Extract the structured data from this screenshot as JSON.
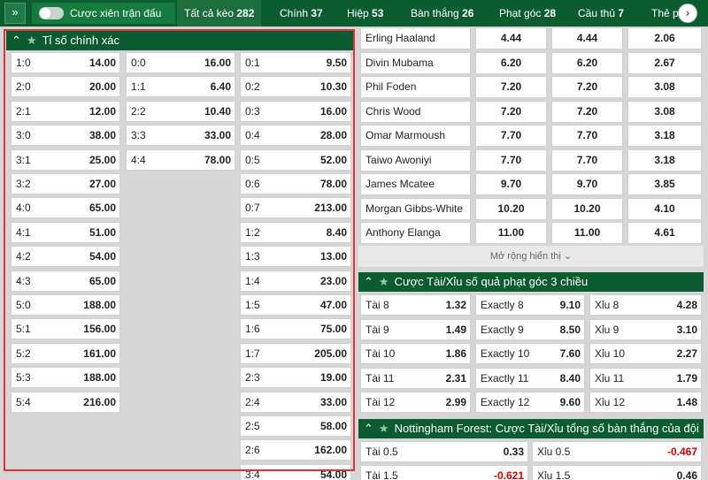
{
  "topbar": {
    "collapse_icon": "chevron-up-double",
    "toggle_label": "Cược xiên trận đấu",
    "tabs": [
      {
        "label": "Tất cả kèo",
        "count": "282",
        "active": true
      },
      {
        "label": "Chính",
        "count": "37"
      },
      {
        "label": "Hiệp",
        "count": "53"
      },
      {
        "label": "Bàn thắng",
        "count": "26"
      },
      {
        "label": "Phạt góc",
        "count": "28"
      },
      {
        "label": "Cầu thủ",
        "count": "7"
      },
      {
        "label": "Thẻ p",
        "count": ""
      }
    ],
    "next_icon": "chevron-right"
  },
  "correct_score": {
    "title": "Tỉ số chính xác",
    "col1": [
      {
        "score": "1:0",
        "odd": "14.00"
      },
      {
        "score": "2:0",
        "odd": "20.00"
      },
      {
        "score": "2:1",
        "odd": "12.00"
      },
      {
        "score": "3:0",
        "odd": "38.00"
      },
      {
        "score": "3:1",
        "odd": "25.00"
      },
      {
        "score": "3:2",
        "odd": "27.00"
      },
      {
        "score": "4:0",
        "odd": "65.00"
      },
      {
        "score": "4:1",
        "odd": "51.00"
      },
      {
        "score": "4:2",
        "odd": "54.00"
      },
      {
        "score": "4:3",
        "odd": "65.00"
      },
      {
        "score": "5:0",
        "odd": "188.00"
      },
      {
        "score": "5:1",
        "odd": "156.00"
      },
      {
        "score": "5:2",
        "odd": "161.00"
      },
      {
        "score": "5:3",
        "odd": "188.00"
      },
      {
        "score": "5:4",
        "odd": "216.00"
      }
    ],
    "col2": [
      {
        "score": "0:0",
        "odd": "16.00"
      },
      {
        "score": "1:1",
        "odd": "6.40"
      },
      {
        "score": "2:2",
        "odd": "10.40"
      },
      {
        "score": "3:3",
        "odd": "33.00"
      },
      {
        "score": "4:4",
        "odd": "78.00"
      }
    ],
    "col3": [
      {
        "score": "0:1",
        "odd": "9.50"
      },
      {
        "score": "0:2",
        "odd": "10.30"
      },
      {
        "score": "0:3",
        "odd": "16.00"
      },
      {
        "score": "0:4",
        "odd": "28.00"
      },
      {
        "score": "0:5",
        "odd": "52.00"
      },
      {
        "score": "0:6",
        "odd": "78.00"
      },
      {
        "score": "0:7",
        "odd": "213.00"
      },
      {
        "score": "1:2",
        "odd": "8.40"
      },
      {
        "score": "1:3",
        "odd": "13.00"
      },
      {
        "score": "1:4",
        "odd": "23.00"
      },
      {
        "score": "1:5",
        "odd": "47.00"
      },
      {
        "score": "1:6",
        "odd": "75.00"
      },
      {
        "score": "1:7",
        "odd": "205.00"
      },
      {
        "score": "2:3",
        "odd": "19.00"
      },
      {
        "score": "2:4",
        "odd": "33.00"
      },
      {
        "score": "2:5",
        "odd": "58.00"
      },
      {
        "score": "2:6",
        "odd": "162.00"
      },
      {
        "score": "3:4",
        "odd": "54.00"
      }
    ]
  },
  "scorers": {
    "rows": [
      {
        "name": "Erling Haaland",
        "o1": "4.44",
        "o2": "4.44",
        "o3": "2.06"
      },
      {
        "name": "Divin Mubama",
        "o1": "6.20",
        "o2": "6.20",
        "o3": "2.67"
      },
      {
        "name": "Phil Foden",
        "o1": "7.20",
        "o2": "7.20",
        "o3": "3.08"
      },
      {
        "name": "Chris Wood",
        "o1": "7.20",
        "o2": "7.20",
        "o3": "3.08"
      },
      {
        "name": "Omar Marmoush",
        "o1": "7.70",
        "o2": "7.70",
        "o3": "3.18"
      },
      {
        "name": "Taiwo Awoniyi",
        "o1": "7.70",
        "o2": "7.70",
        "o3": "3.18"
      },
      {
        "name": "James Mcatee",
        "o1": "9.70",
        "o2": "9.70",
        "o3": "3.85"
      },
      {
        "name": "Morgan Gibbs-White",
        "o1": "10.20",
        "o2": "10.20",
        "o3": "4.10"
      },
      {
        "name": "Anthony Elanga",
        "o1": "11.00",
        "o2": "11.00",
        "o3": "4.61"
      }
    ],
    "expand_label": "Mở rộng hiển thị"
  },
  "corners": {
    "title": "Cược Tài/Xỉu số quả phạt góc 3 chiều",
    "rows": [
      [
        {
          "l": "Tài 8",
          "o": "1.32"
        },
        {
          "l": "Exactly 8",
          "o": "9.10"
        },
        {
          "l": "Xỉu 8",
          "o": "4.28"
        }
      ],
      [
        {
          "l": "Tài 9",
          "o": "1.49"
        },
        {
          "l": "Exactly 9",
          "o": "8.50"
        },
        {
          "l": "Xỉu 9",
          "o": "3.10"
        }
      ],
      [
        {
          "l": "Tài 10",
          "o": "1.86"
        },
        {
          "l": "Exactly 10",
          "o": "7.60"
        },
        {
          "l": "Xỉu 10",
          "o": "2.27"
        }
      ],
      [
        {
          "l": "Tài 11",
          "o": "2.31"
        },
        {
          "l": "Exactly 11",
          "o": "8.40"
        },
        {
          "l": "Xỉu 11",
          "o": "1.79"
        }
      ],
      [
        {
          "l": "Tài 12",
          "o": "2.99"
        },
        {
          "l": "Exactly 12",
          "o": "9.60"
        },
        {
          "l": "Xỉu 12",
          "o": "1.48"
        }
      ]
    ]
  },
  "team_goals": {
    "title": "Nottingham Forest: Cược Tài/Xỉu tổng số bàn thắng của đội",
    "rows": [
      [
        {
          "l": "Tài 0.5",
          "o": "0.33",
          "neg": false
        },
        {
          "l": "Xỉu 0.5",
          "o": "-0.467",
          "neg": true
        }
      ],
      [
        {
          "l": "Tài 1.5",
          "o": "-0.621",
          "neg": true
        },
        {
          "l": "Xỉu 1.5",
          "o": "0.46",
          "neg": false
        }
      ]
    ]
  },
  "colors": {
    "brand_green": "#0b5d31",
    "highlight_red": "#e23232",
    "negative_red": "#d60000"
  }
}
